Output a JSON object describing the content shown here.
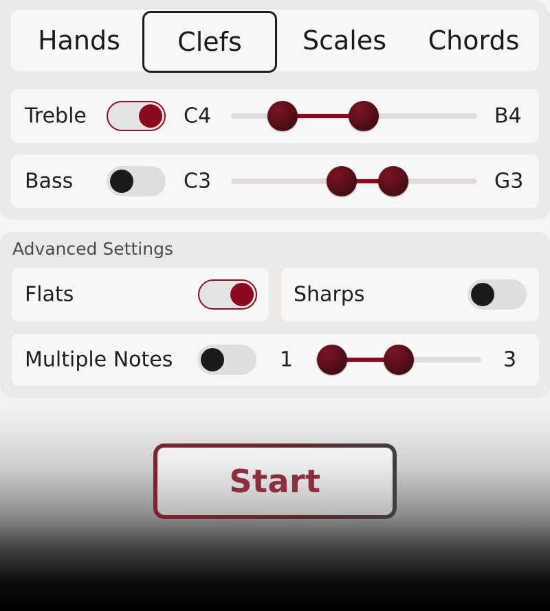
{
  "tabs": [
    {
      "label": "Hands",
      "selected": false
    },
    {
      "label": "Clefs",
      "selected": true
    },
    {
      "label": "Scales",
      "selected": false
    },
    {
      "label": "Chords",
      "selected": false
    }
  ],
  "clefs": {
    "treble": {
      "label": "Treble",
      "enabled": true,
      "low": "C4",
      "high": "B4",
      "range_fraction": [
        0.21,
        0.54
      ]
    },
    "bass": {
      "label": "Bass",
      "enabled": false,
      "low": "C3",
      "high": "G3",
      "range_fraction": [
        0.45,
        0.66
      ]
    }
  },
  "advanced": {
    "title": "Advanced Settings",
    "flats": {
      "label": "Flats",
      "enabled": true
    },
    "sharps": {
      "label": "Sharps",
      "enabled": false
    },
    "multiple_notes": {
      "label": "Multiple Notes",
      "enabled": false,
      "min": "1",
      "max": "3",
      "range_fraction": [
        0.1,
        0.5
      ]
    }
  },
  "start_label": "Start",
  "colors": {
    "accent": "#8c0a1f",
    "knob_off": "#1b1b1b"
  }
}
